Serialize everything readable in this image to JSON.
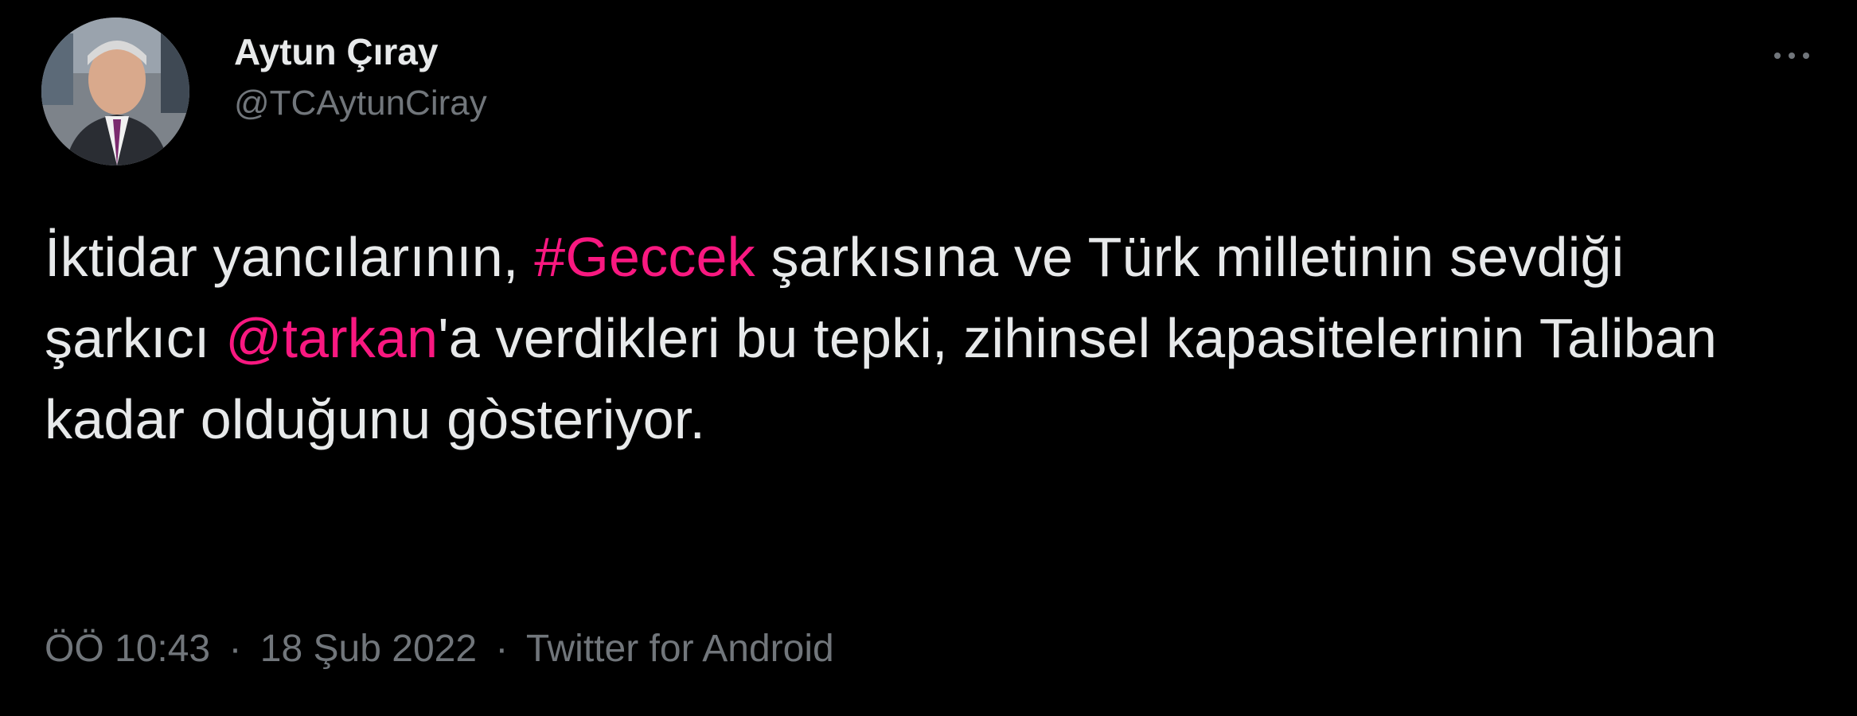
{
  "colors": {
    "background": "#000000",
    "text_primary": "#e7e9ea",
    "text_secondary": "#71767b",
    "accent_link": "#f91880"
  },
  "author": {
    "display_name": "Aytun Çıray",
    "handle": "@TCAytunCiray",
    "avatar_icon": "profile-photo"
  },
  "more_menu_icon": "more-horizontal-icon",
  "tweet": {
    "text_part1": "İktidar yancılarının, ",
    "hashtag": "#Geccek",
    "text_part2": " şarkısına ve Türk milletinin sevdiği şarkıcı ",
    "mention": "@tarkan",
    "text_part3": "'a verdikleri bu tepki, zihinsel kapasitelerinin Taliban kadar olduğunu gòsteriyor."
  },
  "meta": {
    "time": "ÖÖ 10:43",
    "separator": "·",
    "date": "18 Şub 2022",
    "source": "Twitter for Android"
  }
}
